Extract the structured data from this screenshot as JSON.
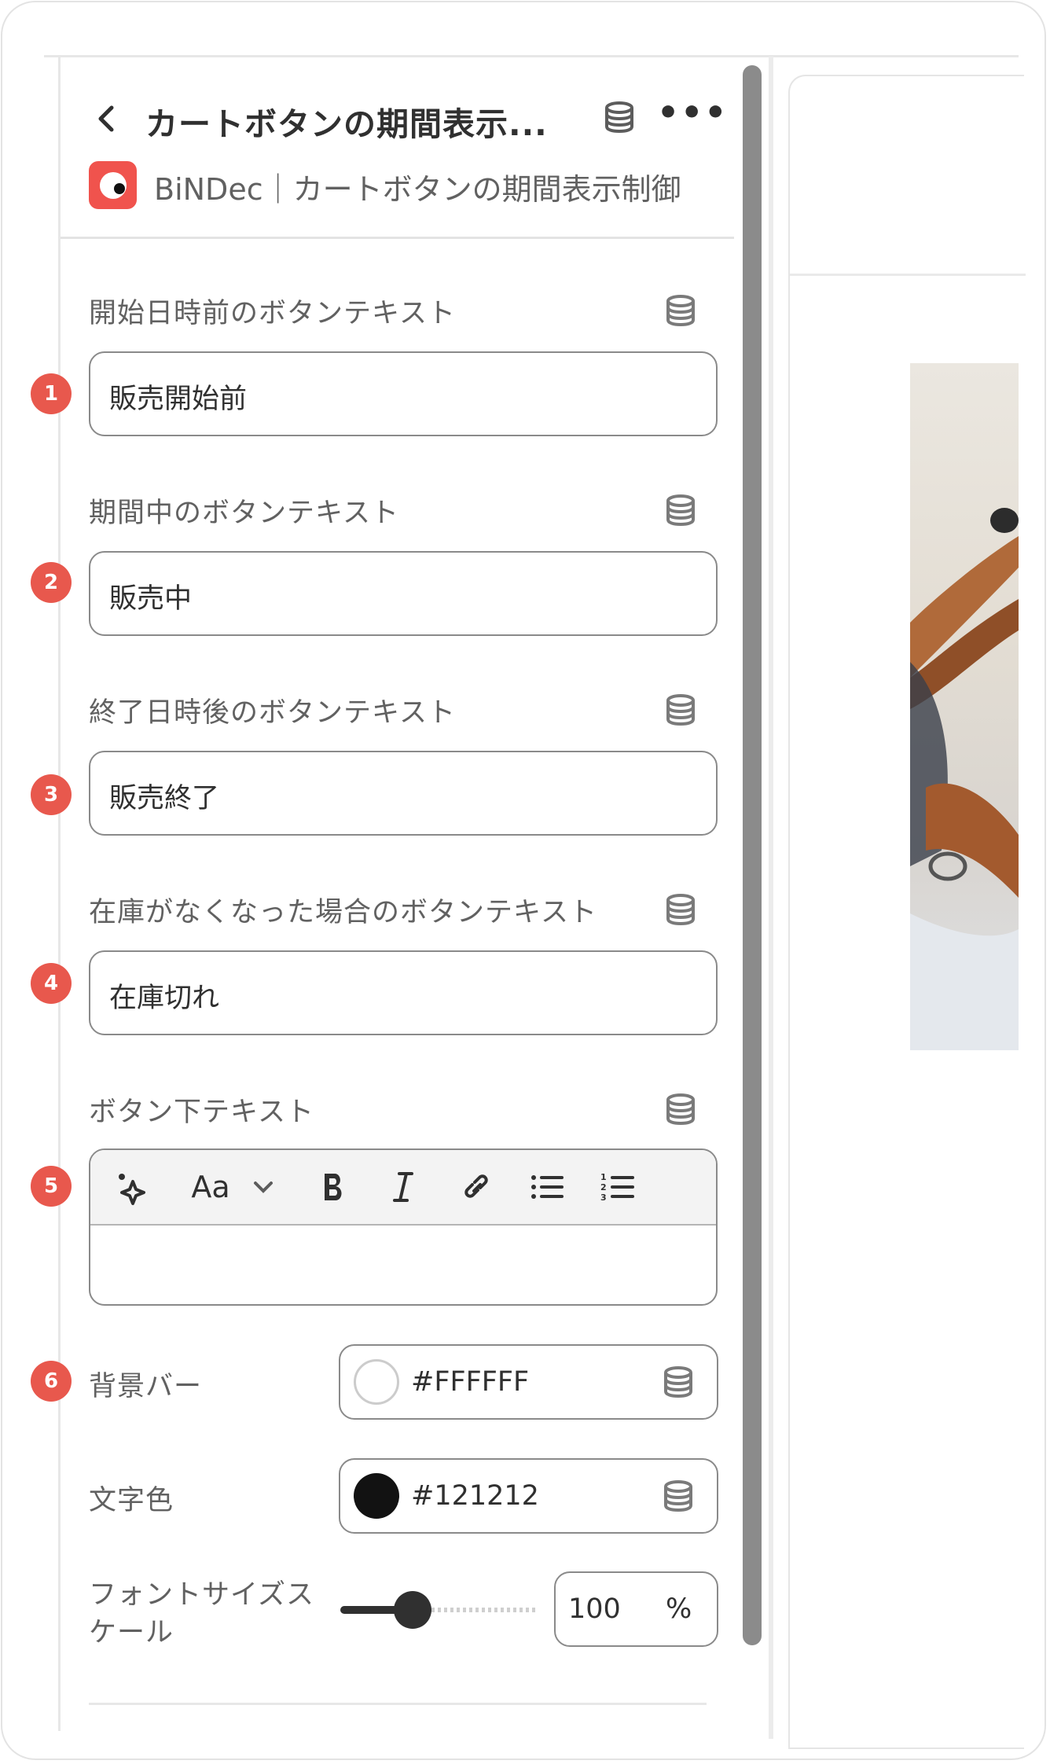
{
  "header": {
    "title": "カートボタンの期間表示...",
    "app_name": "BiNDec",
    "block_name": "カートボタンの期間表示制御",
    "app_line": "BiNDec｜カートボタンの期間表示制御"
  },
  "fields": [
    {
      "badge": "1",
      "label": "開始日時前のボタンテキスト",
      "value": "販売開始前"
    },
    {
      "badge": "2",
      "label": "期間中のボタンテキスト",
      "value": "販売中"
    },
    {
      "badge": "3",
      "label": "終了日時後のボタンテキスト",
      "value": "販売終了"
    },
    {
      "badge": "4",
      "label": "在庫がなくなった場合のボタンテキスト",
      "value": "在庫切れ"
    }
  ],
  "rich_text": {
    "badge": "5",
    "label": "ボタン下テキスト",
    "toolbar_font_label": "Aa",
    "value": ""
  },
  "background_bar": {
    "badge": "6",
    "label": "背景バー",
    "value": "#FFFFFF"
  },
  "text_color": {
    "label": "文字色",
    "value": "#121212"
  },
  "font_scale": {
    "label_line1": "フォントサイズス",
    "label_line2": "ケール",
    "value": "100",
    "unit": "%"
  },
  "colors": {
    "badge": "#e8584d",
    "app_logo": "#f0534d"
  },
  "icons": [
    "back-icon",
    "database-icon",
    "more-icon",
    "ai-sparkle-icon",
    "bold-icon",
    "italic-icon",
    "link-icon",
    "bullet-list-icon",
    "numbered-list-icon"
  ]
}
